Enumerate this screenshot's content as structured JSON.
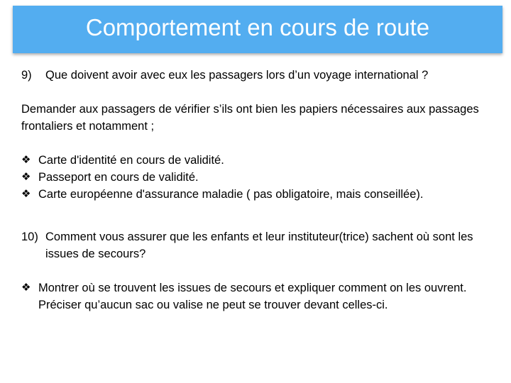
{
  "title": "Comportement en cours de route",
  "colors": {
    "title_bar": "#53adf0",
    "title_text": "#ffffff"
  },
  "q9": {
    "number": "9)",
    "question": "Que doivent avoir avec eux les passagers lors d’un voyage international ?",
    "answer": "Demander aux passagers de vérifier s’ils ont bien les papiers nécessaires aux passages frontaliers et notamment ;",
    "bullet_icon": "diamond-dots-icon",
    "bullets": [
      "Carte d'identité en cours de validité.",
      "Passeport en cours de validité.",
      "Carte européenne d'assurance maladie ( pas obligatoire, mais conseillée)."
    ]
  },
  "q10": {
    "number": "10)",
    "question": "Comment vous assurer que les enfants et leur instituteur(trice) sachent où sont les issues de secours?",
    "bullets": [
      "Montrer où se trouvent les issues de secours et expliquer comment on les ouvrent. Préciser qu’aucun sac ou valise ne peut se trouver devant celles-ci."
    ]
  }
}
